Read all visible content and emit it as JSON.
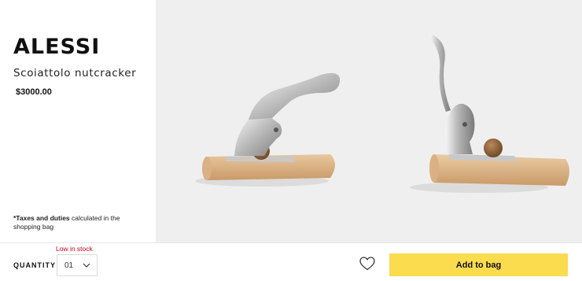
{
  "product": {
    "brand": "ALESSI",
    "name": "Scoiattolo nutcracker",
    "price": "$3000.00",
    "tax_note_bold": "*Taxes and duties",
    "tax_note_rest": " calculated in the shopping bag"
  },
  "purchase": {
    "stock_status": "Low in stock",
    "quantity_label": "QUANTITY",
    "quantity_value": "01",
    "add_to_bag_label": "Add to bag"
  },
  "colors": {
    "add_to_bag_bg": "#fbdc4f",
    "stock_text": "#d0021b",
    "gallery_bg": "#efefef"
  },
  "icons": {
    "wishlist": "heart-outline-icon",
    "quantity_dropdown": "chevron-down-icon"
  }
}
